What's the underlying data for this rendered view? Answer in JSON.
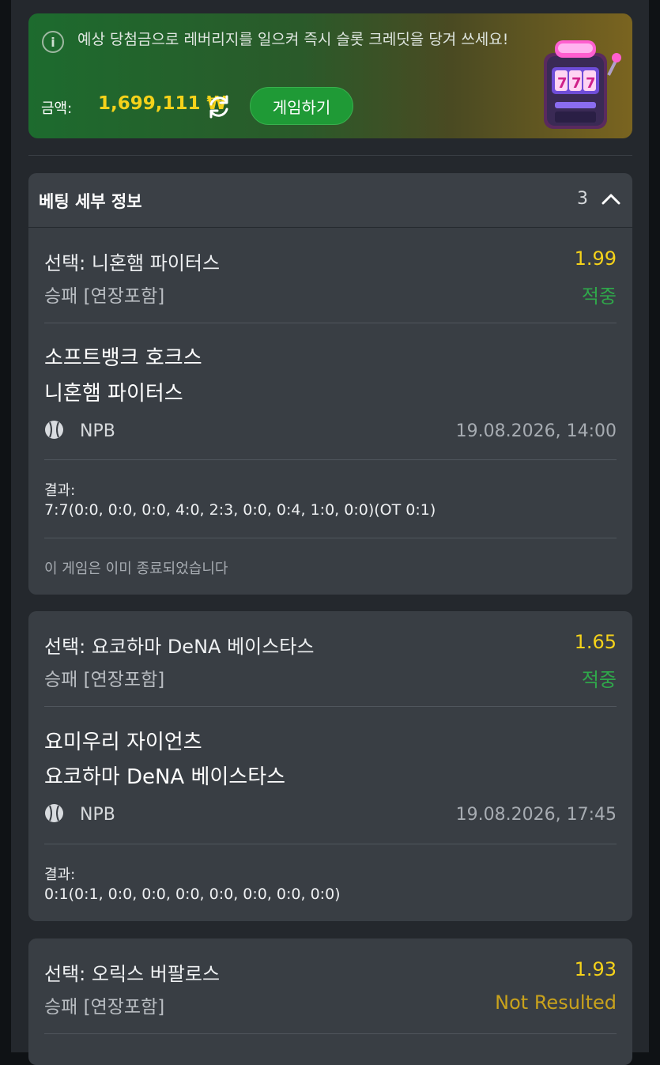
{
  "promo": {
    "message": "예상 당첨금으로 레버리지를 일으켜 즉시 슬롯 크레딧을 당겨 쓰세요!",
    "amount_label": "금액:",
    "amount_value": "1,699,111 ₩",
    "play_button": "게임하기",
    "icons": {
      "info": "info-icon",
      "refresh": "refresh-icon",
      "slot": "slot-machine-icon"
    },
    "colors": {
      "amount": "#f5d21a",
      "button": "#1f9a36"
    }
  },
  "details": {
    "title": "베팅 세부 정보",
    "count": "3",
    "chevron": "chevron-up-icon"
  },
  "bets": [
    {
      "selection": "선택: 니혼햄 파이터스",
      "odds": "1.99",
      "market": "승패 [연장포함]",
      "status": "적중",
      "home": "소프트뱅크 호크스",
      "away": "니혼햄 파이터스",
      "league": "NPB",
      "datetime": "19.08.2026, 14:00",
      "result_label": "결과:",
      "result": "7:7(0:0, 0:0, 0:0, 4:0, 2:3, 0:0, 0:4, 1:0, 0:0)(OT 0:1)",
      "note": "이 게임은 이미 종료되었습니다"
    },
    {
      "selection": "선택: 요코하마 DeNA 베이스타스",
      "odds": "1.65",
      "market": "승패 [연장포함]",
      "status": "적중",
      "home": "요미우리 자이언츠",
      "away": "요코하마 DeNA 베이스타스",
      "league": "NPB",
      "datetime": "19.08.2026, 17:45",
      "result_label": "결과:",
      "result": "0:1(0:1, 0:0, 0:0, 0:0, 0:0, 0:0, 0:0, 0:0)"
    },
    {
      "selection": "선택: 오릭스 버팔로스",
      "odds": "1.93",
      "market": "승패 [연장포함]",
      "status": "Not Resulted"
    }
  ]
}
